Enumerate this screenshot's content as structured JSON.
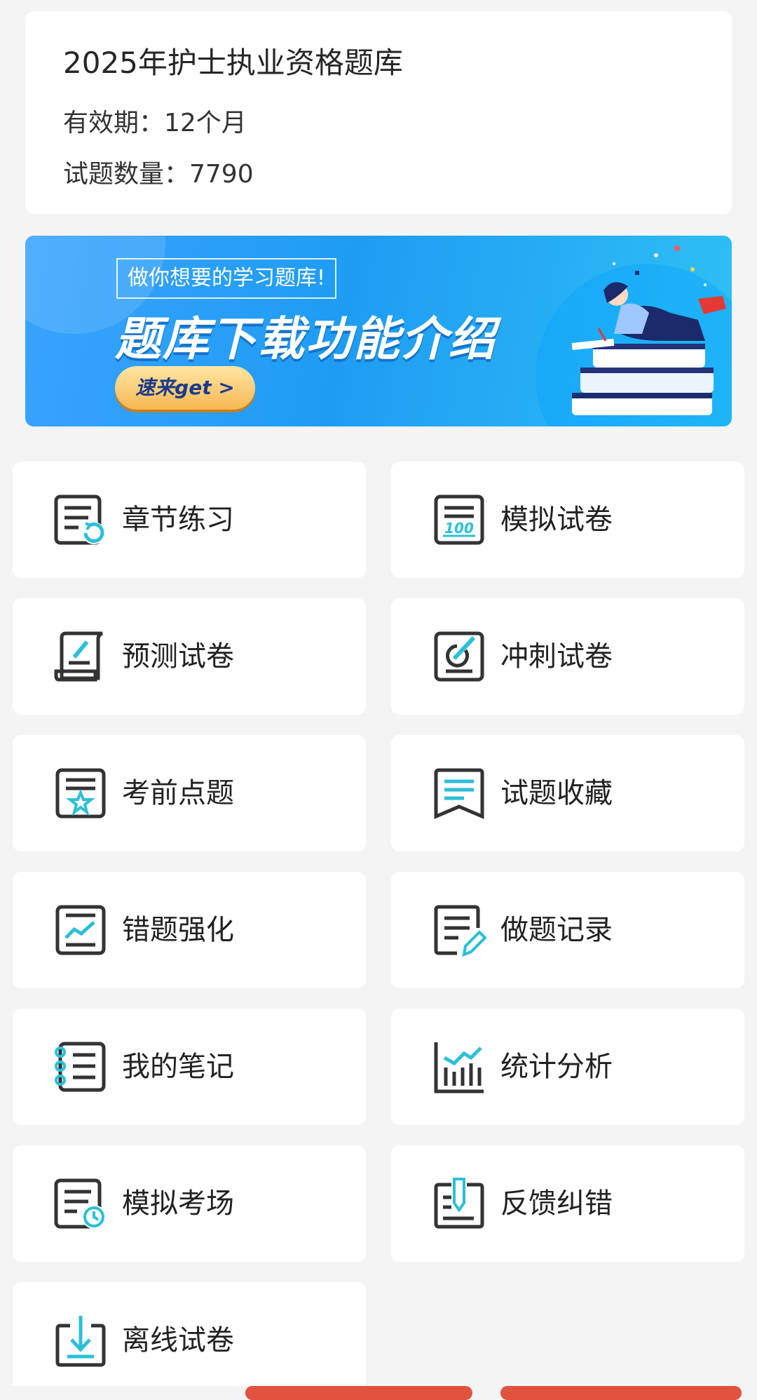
{
  "info": {
    "title": "2025年护士执业资格题库",
    "validity": "有效期：12个月",
    "count": "试题数量：7790"
  },
  "banner": {
    "subtitle": "做你想要的学习题库!",
    "main": "题库下载功能介绍",
    "button": "速来get >"
  },
  "tiles": [
    {
      "label": "章节练习",
      "icon": "chapter-practice-icon"
    },
    {
      "label": "模拟试卷",
      "icon": "mock-paper-icon"
    },
    {
      "label": "预测试卷",
      "icon": "prediction-paper-icon"
    },
    {
      "label": "冲刺试卷",
      "icon": "sprint-paper-icon"
    },
    {
      "label": "考前点题",
      "icon": "exam-tips-icon"
    },
    {
      "label": "试题收藏",
      "icon": "favorites-icon"
    },
    {
      "label": "错题强化",
      "icon": "wrong-questions-icon"
    },
    {
      "label": "做题记录",
      "icon": "practice-record-icon"
    },
    {
      "label": "我的笔记",
      "icon": "notes-icon"
    },
    {
      "label": "统计分析",
      "icon": "statistics-icon"
    },
    {
      "label": "模拟考场",
      "icon": "mock-exam-room-icon"
    },
    {
      "label": "反馈纠错",
      "icon": "feedback-icon"
    },
    {
      "label": "离线试卷",
      "icon": "offline-paper-icon"
    }
  ],
  "colors": {
    "accent": "#2bbfd8",
    "icon_stroke": "#333333",
    "banner": "#1e9cf3",
    "bottom_button": "#e0533f"
  }
}
